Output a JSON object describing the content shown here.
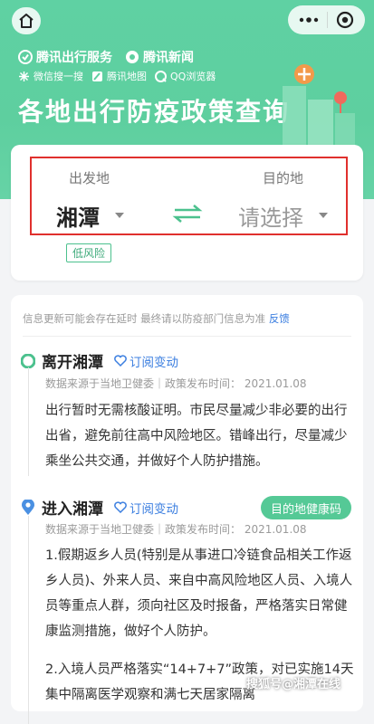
{
  "header": {
    "brands_row1": [
      "腾讯出行服务",
      "腾讯新闻"
    ],
    "brands_row2": [
      "微信搜一搜",
      "腾讯地图",
      "QQ浏览器"
    ],
    "title": "各地出行防疫政策查询"
  },
  "query": {
    "from_label": "出发地",
    "to_label": "目的地",
    "from_city": "湘潭",
    "to_city_placeholder": "请选择",
    "risk_badge": "低风险"
  },
  "notice": {
    "text": "信息更新可能会存在延时 最终请以防疫部门信息为准",
    "link": "反馈"
  },
  "leave": {
    "title": "离开湘潭",
    "subscribe": "订阅变动",
    "source": "数据来源于当地卫健委｜政策发布时间：  2021.01.08",
    "body": "出行暂时无需核酸证明。市民尽量减少非必要的出行出省，避免前往高中风险地区。错峰出行，尽量减少乘坐公共交通，并做好个人防护措施。"
  },
  "enter": {
    "title": "进入湘潭",
    "subscribe": "订阅变动",
    "health_code": "目的地健康码",
    "source": "数据来源于当地卫健委｜政策发布时间：  2021.01.08",
    "body1": "1.假期返乡人员(特别是从事进口冷链食品相关工作返乡人员)、外来人员、来自中高风险地区人员、入境人员等重点人群，须向社区及时报备，严格落实日常健康监测措施，做好个人防护。",
    "body2": "2.入境人员严格落实“14+7+7”政策，对已实施14天集中隔离医学观察和满七天居家隔离"
  },
  "watermark": "搜狐号@湘潭在线",
  "colors": {
    "brand_green": "#5ecf9f",
    "link_blue": "#3c7fe0",
    "highlight_red": "#e0302d"
  }
}
